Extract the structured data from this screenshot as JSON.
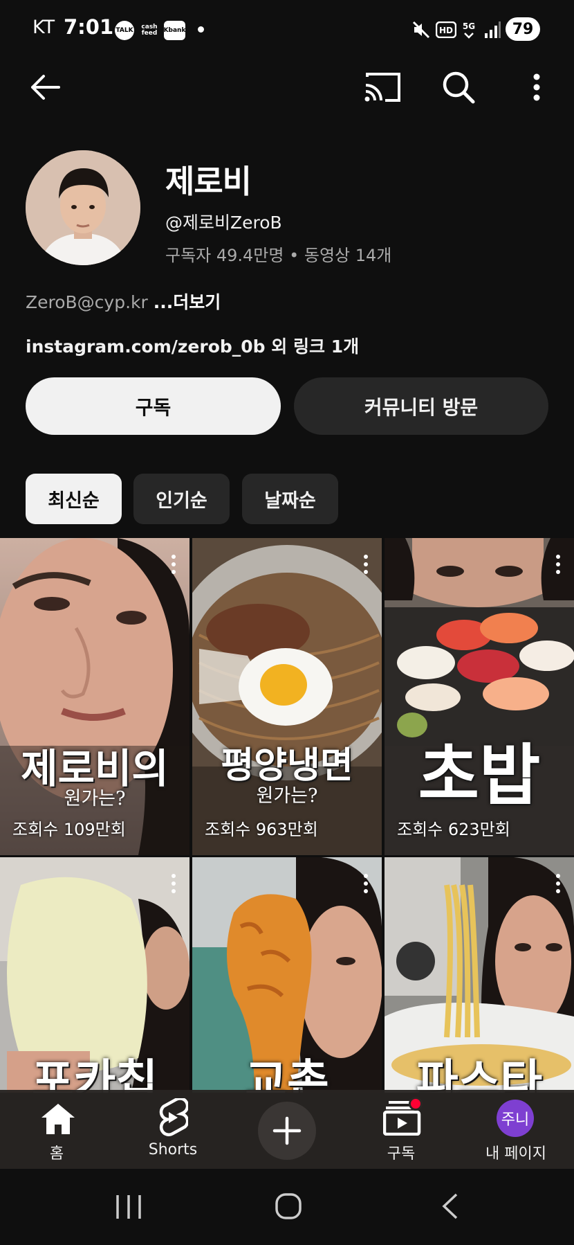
{
  "status_bar": {
    "carrier": "KT",
    "time": "7:01",
    "app_icons": [
      "TALK",
      "cash feed",
      "Kbank"
    ],
    "battery": "79"
  },
  "channel": {
    "name": "제로비",
    "handle": "@제로비ZeroB",
    "meta": "구독자 49.4만명 • 동영상 14개",
    "description_preview": "ZeroB@cyp.kr",
    "more_label": "...더보기",
    "link": "instagram.com/zerob_0b 외 링크 1개"
  },
  "actions": {
    "subscribe_label": "구독",
    "community_label": "커뮤니티 방문"
  },
  "filters": [
    {
      "label": "최신순",
      "selected": true
    },
    {
      "label": "인기순",
      "selected": false
    },
    {
      "label": "날짜순",
      "selected": false
    }
  ],
  "shorts": [
    {
      "title": "제로비의",
      "subtitle": "원가는?",
      "views": "조회수 109만회"
    },
    {
      "title": "평양냉면",
      "subtitle": "원가는?",
      "views": "조회수 963만회"
    },
    {
      "title": "초밥",
      "subtitle": "",
      "views": "조회수 623만회"
    },
    {
      "title": "포카칩",
      "subtitle": "",
      "views": ""
    },
    {
      "title": "교촌",
      "subtitle": "",
      "views": ""
    },
    {
      "title": "파스타",
      "subtitle": "",
      "views": ""
    }
  ],
  "bottom_nav": {
    "home": "홈",
    "shorts": "Shorts",
    "subscriptions": "구독",
    "you": "내 페이지",
    "avatar_text": "주니"
  },
  "colors": {
    "background": "#0f0f0f",
    "chip_selected": "#f1f1f1",
    "chip_default": "#272727",
    "notification_dot": "#ff0033",
    "avatar_badge": "#7e3fd1"
  }
}
